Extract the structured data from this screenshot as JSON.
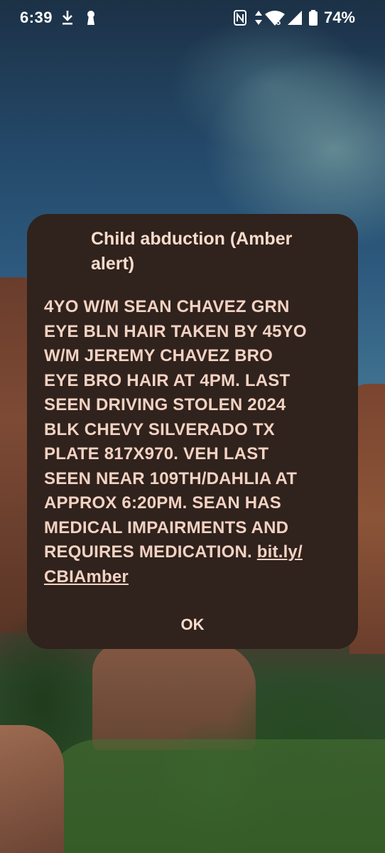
{
  "status_bar": {
    "time": "6:39",
    "battery_percent": "74%",
    "icons": [
      "download-icon",
      "keyhole-icon",
      "nfc-icon",
      "data-arrows-icon",
      "wifi-icon",
      "cell-signal-icon",
      "battery-icon"
    ],
    "wifi_badge": "5",
    "battery_level": 0.74
  },
  "alert": {
    "title": "Child abduction (Amber alert)",
    "message": "4YO W/M SEAN CHAVEZ GRN\nEYE BLN HAIR TAKEN BY 45YO\nW/M JEREMY CHAVEZ BRO\nEYE BRO HAIR AT 4PM. LAST\nSEEN DRIVING STOLEN 2024\nBLK CHEVY SILVERADO TX\nPLATE 817X970. VEH LAST\nSEEN NEAR 109TH/DAHLIA AT\nAPPROX 6:20PM. SEAN HAS\nMEDICAL IMPAIRMENTS AND\nREQUIRES MEDICATION. ",
    "link_text": "bit.ly/\nCBIAmber",
    "ok_label": "OK"
  },
  "colors": {
    "dialog_bg": "#30221c",
    "dialog_text": "#f2d2c3",
    "status_text": "#ffffff"
  }
}
